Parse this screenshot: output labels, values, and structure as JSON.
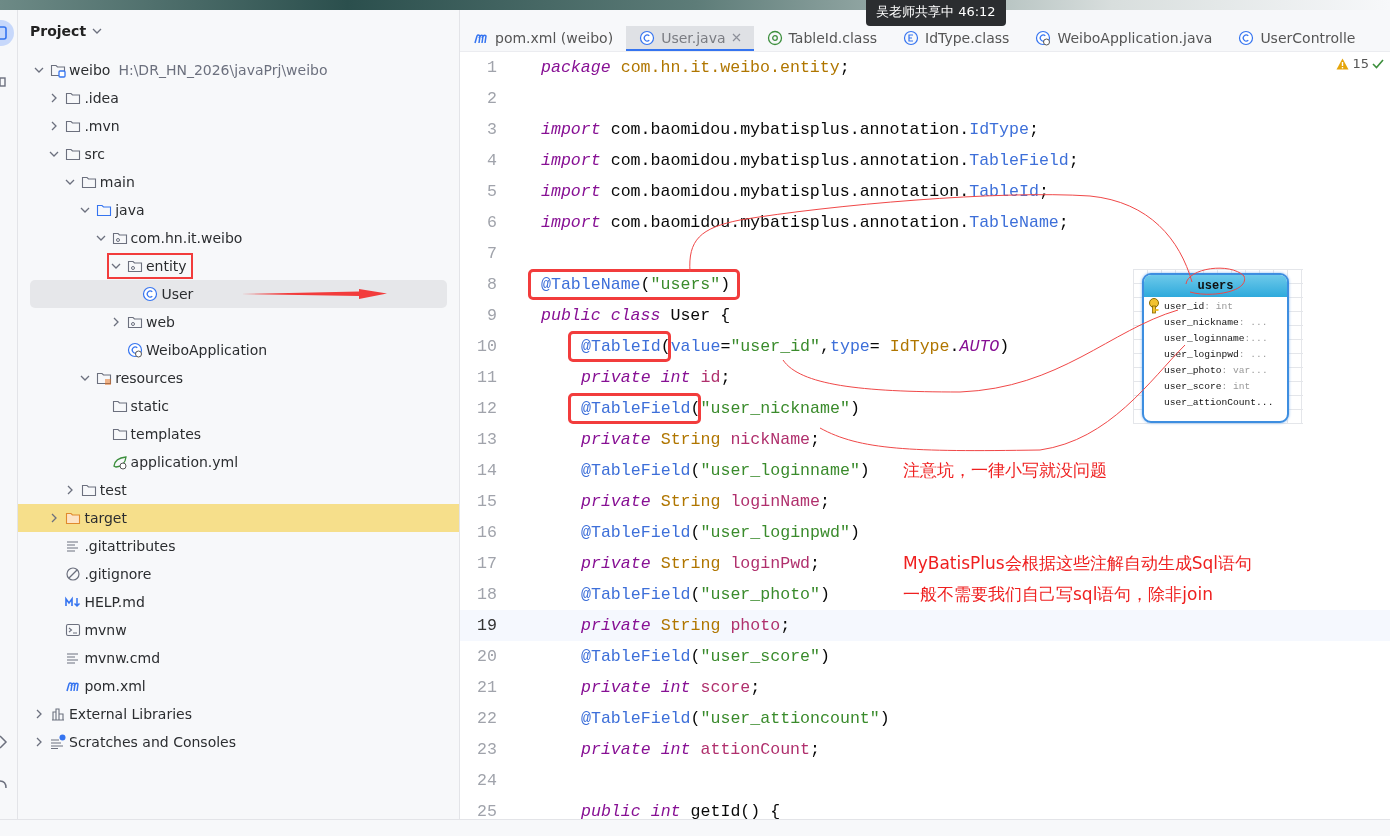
{
  "project_panel": {
    "title": "Project",
    "tree": [
      {
        "label": "weibo",
        "path": "H:\\DR_HN_2026\\javaPrj\\weibo",
        "kind": "project",
        "expanded": true,
        "selected": false,
        "highlighted": false,
        "children": [
          {
            "label": ".idea",
            "kind": "folder",
            "expanded": false,
            "selected": false,
            "highlighted": false
          },
          {
            "label": ".mvn",
            "kind": "folder",
            "expanded": false,
            "selected": false,
            "highlighted": false
          },
          {
            "label": "src",
            "kind": "folder",
            "expanded": true,
            "selected": false,
            "highlighted": false,
            "children": [
              {
                "label": "main",
                "kind": "folder",
                "expanded": true,
                "selected": false,
                "highlighted": false,
                "children": [
                  {
                    "label": "java",
                    "kind": "source",
                    "expanded": true,
                    "selected": false,
                    "highlighted": false,
                    "children": [
                      {
                        "label": "com.hn.it.weibo",
                        "kind": "package",
                        "expanded": true,
                        "selected": false,
                        "highlighted": false,
                        "children": [
                          {
                            "label": "entity",
                            "kind": "package",
                            "expanded": true,
                            "selected": false,
                            "highlighted": false,
                            "boxed": true,
                            "children": [
                              {
                                "label": "User",
                                "kind": "class",
                                "selected": true,
                                "highlighted": false,
                                "arrow": true
                              }
                            ]
                          },
                          {
                            "label": "web",
                            "kind": "package",
                            "expanded": false,
                            "selected": false,
                            "highlighted": false
                          },
                          {
                            "label": "WeiboApplication",
                            "kind": "spring-class",
                            "selected": false,
                            "highlighted": false
                          }
                        ]
                      }
                    ]
                  },
                  {
                    "label": "resources",
                    "kind": "resources",
                    "expanded": true,
                    "selected": false,
                    "highlighted": false,
                    "children": [
                      {
                        "label": "static",
                        "kind": "folder",
                        "selected": false,
                        "highlighted": false
                      },
                      {
                        "label": "templates",
                        "kind": "folder",
                        "selected": false,
                        "highlighted": false
                      },
                      {
                        "label": "application.yml",
                        "kind": "yaml",
                        "selected": false,
                        "highlighted": false
                      }
                    ]
                  }
                ]
              },
              {
                "label": "test",
                "kind": "folder",
                "expanded": false,
                "selected": false,
                "highlighted": false
              }
            ]
          },
          {
            "label": "target",
            "kind": "excluded",
            "expanded": false,
            "selected": false,
            "highlighted": true
          },
          {
            "label": ".gitattributes",
            "kind": "text",
            "selected": false,
            "highlighted": false
          },
          {
            "label": ".gitignore",
            "kind": "ignore",
            "selected": false,
            "highlighted": false
          },
          {
            "label": "HELP.md",
            "kind": "markdown",
            "selected": false,
            "highlighted": false
          },
          {
            "label": "mvnw",
            "kind": "shell",
            "selected": false,
            "highlighted": false
          },
          {
            "label": "mvnw.cmd",
            "kind": "text",
            "selected": false,
            "highlighted": false
          },
          {
            "label": "pom.xml",
            "kind": "maven",
            "selected": false,
            "highlighted": false
          }
        ]
      },
      {
        "label": "External Libraries",
        "kind": "libraries",
        "expanded": false,
        "selected": false,
        "highlighted": false
      },
      {
        "label": "Scratches and Consoles",
        "kind": "scratches",
        "expanded": false,
        "selected": false,
        "highlighted": false
      }
    ]
  },
  "editor": {
    "tabs": [
      {
        "label": "pom.xml (weibo)",
        "kind": "maven",
        "selected": false
      },
      {
        "label": "User.java",
        "kind": "class",
        "selected": true,
        "closable": true
      },
      {
        "label": "TableId.class",
        "kind": "annotation",
        "selected": false
      },
      {
        "label": "IdType.class",
        "kind": "enum",
        "selected": false
      },
      {
        "label": "WeiboApplication.java",
        "kind": "spring-class",
        "selected": false
      },
      {
        "label": "UserControlle",
        "kind": "class",
        "selected": false
      }
    ],
    "tooltip": "吴老师共享中 46:12",
    "warnings": "15",
    "lines": [
      {
        "n": "1",
        "current": false,
        "indent": false,
        "tokens": [
          {
            "kind": "kw",
            "t": "package "
          },
          {
            "kind": "pkg",
            "t": "com.hn.it.weibo.entity"
          },
          {
            "kind": "plain",
            "t": ";"
          }
        ]
      },
      {
        "n": "2",
        "current": false
      },
      {
        "n": "3",
        "current": false,
        "indent": false,
        "tokens": [
          {
            "kind": "kw",
            "t": "import"
          },
          {
            "kind": "plain",
            "t": " com.baomidou.mybatisplus.annotation."
          },
          {
            "kind": "ann",
            "t": "IdType"
          },
          {
            "kind": "plain",
            "t": ";"
          }
        ]
      },
      {
        "n": "4",
        "current": false,
        "indent": false,
        "tokens": [
          {
            "kind": "kw",
            "t": "import"
          },
          {
            "kind": "plain",
            "t": " com.baomidou.mybatisplus.annotation."
          },
          {
            "kind": "ann",
            "t": "TableField"
          },
          {
            "kind": "plain",
            "t": ";"
          }
        ]
      },
      {
        "n": "5",
        "current": false,
        "indent": false,
        "tokens": [
          {
            "kind": "kw",
            "t": "import"
          },
          {
            "kind": "plain",
            "t": " com.baomidou.mybatisplus.annotation."
          },
          {
            "kind": "ann",
            "t": "TableId"
          },
          {
            "kind": "plain",
            "t": ";"
          }
        ]
      },
      {
        "n": "6",
        "current": false,
        "indent": false,
        "tokens": [
          {
            "kind": "kw",
            "t": "import"
          },
          {
            "kind": "plain",
            "t": " com.baomidou.mybatisplus.annotation."
          },
          {
            "kind": "ann",
            "t": "TableName"
          },
          {
            "kind": "plain",
            "t": ";"
          }
        ]
      },
      {
        "n": "7",
        "current": false
      },
      {
        "n": "8",
        "current": false,
        "indent": false,
        "tokens": [
          {
            "kind": "ann",
            "t": "@TableName",
            "boxed": true
          },
          {
            "kind": "plain",
            "t": "(",
            "boxed": true
          },
          {
            "kind": "str",
            "t": "\"users\"",
            "boxed": true
          },
          {
            "kind": "plain",
            "t": ")",
            "boxed": true
          }
        ]
      },
      {
        "n": "9",
        "current": false,
        "indent": false,
        "tokens": [
          {
            "kind": "kw",
            "t": "public class"
          },
          {
            "kind": "plain",
            "t": " User {"
          }
        ]
      },
      {
        "n": "10",
        "current": false,
        "indent": true,
        "tokens": [
          {
            "kind": "ann",
            "t": "@TableId",
            "boxed": true
          },
          {
            "kind": "plain",
            "t": "("
          },
          {
            "kind": "ann",
            "t": "value"
          },
          {
            "kind": "plain",
            "t": "="
          },
          {
            "kind": "str",
            "t": "\"user_id\""
          },
          {
            "kind": "plain",
            "t": ","
          },
          {
            "kind": "ann",
            "t": "type"
          },
          {
            "kind": "plain",
            "t": "= "
          },
          {
            "kind": "type",
            "t": "IdType"
          },
          {
            "kind": "plain",
            "t": "."
          },
          {
            "kind": "const",
            "t": "AUTO"
          },
          {
            "kind": "plain",
            "t": ")"
          }
        ]
      },
      {
        "n": "11",
        "current": false,
        "indent": true,
        "tokens": [
          {
            "kind": "kw",
            "t": "private int "
          },
          {
            "kind": "field",
            "t": "id"
          },
          {
            "kind": "plain",
            "t": ";"
          }
        ]
      },
      {
        "n": "12",
        "current": false,
        "indent": true,
        "tokens": [
          {
            "kind": "ann",
            "t": "@TableField",
            "boxed": true
          },
          {
            "kind": "plain",
            "t": "("
          },
          {
            "kind": "str",
            "t": "\"user_nickname\""
          },
          {
            "kind": "plain",
            "t": ")"
          }
        ]
      },
      {
        "n": "13",
        "current": false,
        "indent": true,
        "tokens": [
          {
            "kind": "kw",
            "t": "private "
          },
          {
            "kind": "type",
            "t": "String "
          },
          {
            "kind": "field",
            "t": "nickName"
          },
          {
            "kind": "plain",
            "t": ";"
          }
        ]
      },
      {
        "n": "14",
        "current": false,
        "indent": true,
        "tokens": [
          {
            "kind": "ann",
            "t": "@TableField"
          },
          {
            "kind": "plain",
            "t": "("
          },
          {
            "kind": "str",
            "t": "\"user_loginname\""
          },
          {
            "kind": "plain",
            "t": ")"
          }
        ],
        "note": "注意坑，一律小写就没问题"
      },
      {
        "n": "15",
        "current": false,
        "indent": true,
        "tokens": [
          {
            "kind": "kw",
            "t": "private "
          },
          {
            "kind": "type",
            "t": "String "
          },
          {
            "kind": "field",
            "t": "loginName"
          },
          {
            "kind": "plain",
            "t": ";"
          }
        ]
      },
      {
        "n": "16",
        "current": false,
        "indent": true,
        "tokens": [
          {
            "kind": "ann",
            "t": "@TableField"
          },
          {
            "kind": "plain",
            "t": "("
          },
          {
            "kind": "str",
            "t": "\"user_loginpwd\""
          },
          {
            "kind": "plain",
            "t": ")"
          }
        ]
      },
      {
        "n": "17",
        "current": false,
        "indent": true,
        "tokens": [
          {
            "kind": "kw",
            "t": "private "
          },
          {
            "kind": "type",
            "t": "String "
          },
          {
            "kind": "field",
            "t": "loginPwd"
          },
          {
            "kind": "plain",
            "t": ";"
          }
        ],
        "note": "MyBatisPlus会根据这些注解自动生成Sql语句"
      },
      {
        "n": "18",
        "current": false,
        "indent": true,
        "tokens": [
          {
            "kind": "ann",
            "t": "@TableField"
          },
          {
            "kind": "plain",
            "t": "("
          },
          {
            "kind": "str",
            "t": "\"user_photo\""
          },
          {
            "kind": "plain",
            "t": ")"
          }
        ],
        "note": "一般不需要我们自己写sql语句，除非join"
      },
      {
        "n": "19",
        "current": true,
        "indent": true,
        "tokens": [
          {
            "kind": "kw",
            "t": "private "
          },
          {
            "kind": "type",
            "t": "String "
          },
          {
            "kind": "field",
            "t": "photo"
          },
          {
            "kind": "plain",
            "t": ";"
          }
        ]
      },
      {
        "n": "20",
        "current": false,
        "indent": true,
        "tokens": [
          {
            "kind": "ann",
            "t": "@TableField"
          },
          {
            "kind": "plain",
            "t": "("
          },
          {
            "kind": "str",
            "t": "\"user_score\""
          },
          {
            "kind": "plain",
            "t": ")"
          }
        ]
      },
      {
        "n": "21",
        "current": false,
        "indent": true,
        "tokens": [
          {
            "kind": "kw",
            "t": "private int "
          },
          {
            "kind": "field",
            "t": "score"
          },
          {
            "kind": "plain",
            "t": ";"
          }
        ]
      },
      {
        "n": "22",
        "current": false,
        "indent": true,
        "tokens": [
          {
            "kind": "ann",
            "t": "@TableField"
          },
          {
            "kind": "plain",
            "t": "("
          },
          {
            "kind": "str",
            "t": "\"user_attioncount\""
          },
          {
            "kind": "plain",
            "t": ")"
          }
        ]
      },
      {
        "n": "23",
        "current": false,
        "indent": true,
        "tokens": [
          {
            "kind": "kw",
            "t": "private int "
          },
          {
            "kind": "field",
            "t": "attionCount"
          },
          {
            "kind": "plain",
            "t": ";"
          }
        ]
      },
      {
        "n": "24",
        "current": false
      },
      {
        "n": "25",
        "current": false,
        "indent": true,
        "tokens": [
          {
            "kind": "kw",
            "t": "public int "
          },
          {
            "kind": "plain",
            "t": "getId() {"
          }
        ]
      }
    ]
  },
  "db_diagram": {
    "table": "users",
    "columns": [
      {
        "name": "user_id",
        "type": ": int",
        "key": true
      },
      {
        "name": "user_nickname",
        "type": ": ...",
        "key": false
      },
      {
        "name": "user_loginname",
        "type": ":...",
        "key": false
      },
      {
        "name": "user_loginpwd",
        "type": ": ...",
        "key": false
      },
      {
        "name": "user_photo",
        "type": ": var...",
        "key": false
      },
      {
        "name": "user_score",
        "type": ": int",
        "key": false
      },
      {
        "name": "user_attionCount...",
        "key": false
      }
    ]
  }
}
